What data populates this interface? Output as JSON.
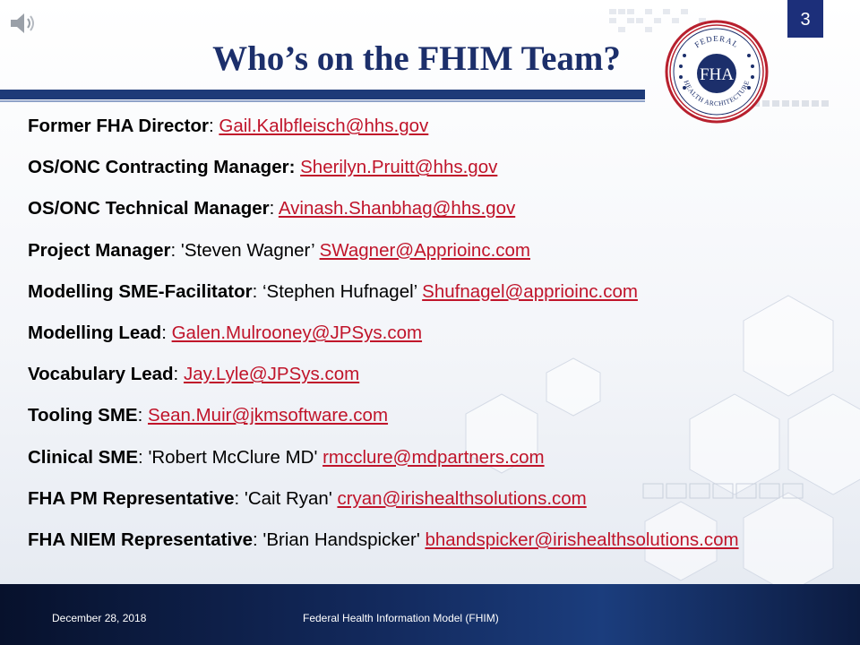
{
  "slide": {
    "title": "Who’s on the FHIM Team?",
    "page_number": "3"
  },
  "logo": {
    "arc_top": "FEDERAL",
    "arc_bottom": "HEALTH ARCHITECTURE",
    "abbr": "FHA"
  },
  "team": [
    {
      "label": "Former FHA Director",
      "sep": ": ",
      "name": "",
      "email": "Gail.Kalbfleisch@hhs.gov"
    },
    {
      "label": "OS/ONC Contracting Manager:",
      "sep": " ",
      "name": "",
      "email": "Sherilyn.Pruitt@hhs.gov"
    },
    {
      "label": "OS/ONC Technical Manager",
      "sep": ": ",
      "name": "",
      "email": "Avinash.Shanbhag@hhs.gov"
    },
    {
      "label": "Project Manager",
      "sep": ": ",
      "name": "'Steven Wagner’ ",
      "email": "SWagner@Apprioinc.com"
    },
    {
      "label": "Modelling SME-Facilitator",
      "sep": ": ",
      "name": "‘Stephen Hufnagel’ ",
      "email": "Shufnagel@apprioinc.com"
    },
    {
      "label": "Modelling Lead",
      "sep": ": ",
      "name": "",
      "email": "Galen.Mulrooney@JPSys.com"
    },
    {
      "label": "Vocabulary Lead",
      "sep": ": ",
      "name": "",
      "email": "Jay.Lyle@JPSys.com"
    },
    {
      "label": "Tooling SME",
      "sep": ": ",
      "name": "",
      "email": "Sean.Muir@jkmsoftware.com"
    },
    {
      "label": "Clinical SME",
      "sep": ": ",
      "name": "'Robert McClure MD' ",
      "email": "rmcclure@mdpartners.com"
    },
    {
      "label": "FHA PM Representative",
      "sep": ": ",
      "name": "'Cait Ryan' ",
      "email": "cryan@irishealthsolutions.com"
    },
    {
      "label": "FHA NIEM Representative",
      "sep": ": ",
      "name": "'Brian Handspicker' ",
      "email": "bhandspicker@irishealthsolutions.com"
    }
  ],
  "footer": {
    "date": "December  28, 2018",
    "title": "Federal Health Information Model (FHIM)"
  },
  "colors": {
    "title": "#1c2f6b",
    "link": "#c0142a",
    "rule": "#1e3a78",
    "badge": "#1c2f7a",
    "seal_red": "#b8202e",
    "seal_blue": "#1c2f6b"
  }
}
